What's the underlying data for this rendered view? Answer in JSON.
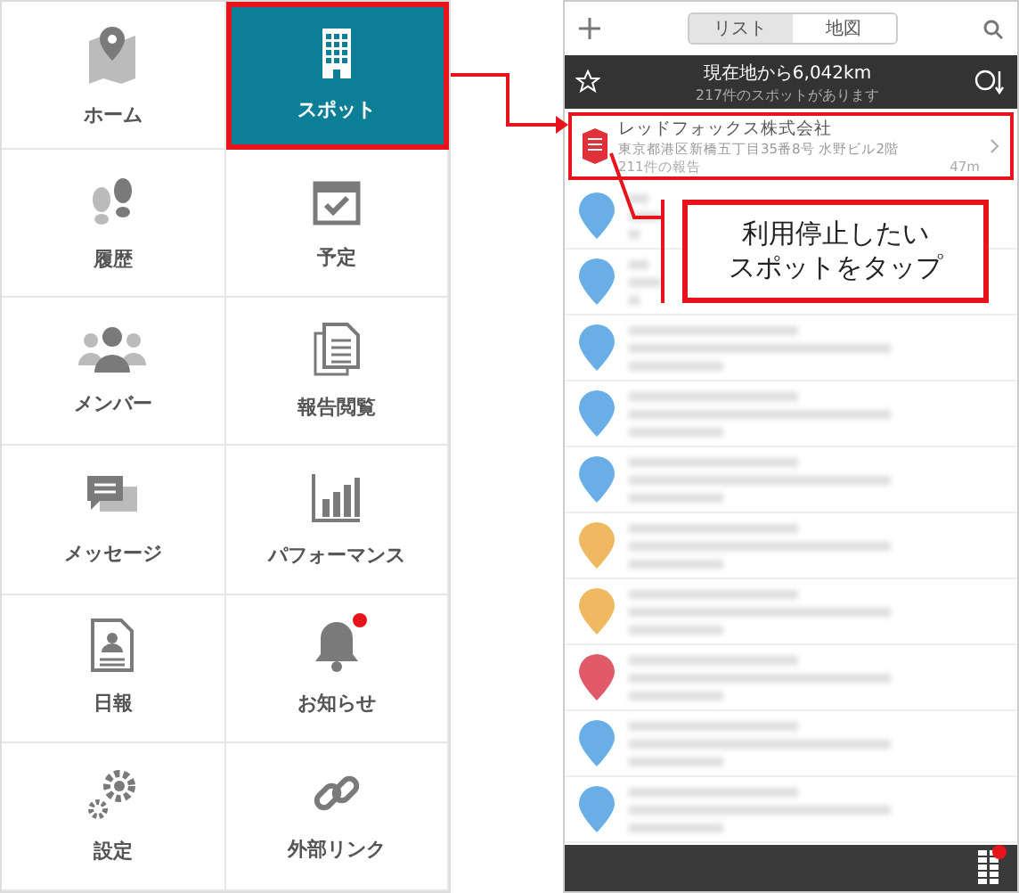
{
  "menu": [
    {
      "label": "ホーム",
      "selected": false,
      "badge": false
    },
    {
      "label": "スポット",
      "selected": true,
      "badge": false
    },
    {
      "label": "履歴",
      "selected": false,
      "badge": false
    },
    {
      "label": "予定",
      "selected": false,
      "badge": false
    },
    {
      "label": "メンバー",
      "selected": false,
      "badge": false
    },
    {
      "label": "報告閲覧",
      "selected": false,
      "badge": false
    },
    {
      "label": "メッセージ",
      "selected": false,
      "badge": false
    },
    {
      "label": "パフォーマンス",
      "selected": false,
      "badge": false
    },
    {
      "label": "日報",
      "selected": false,
      "badge": false
    },
    {
      "label": "お知らせ",
      "selected": false,
      "badge": true
    },
    {
      "label": "設定",
      "selected": false,
      "badge": false
    },
    {
      "label": "外部リンク",
      "selected": false,
      "badge": false
    }
  ],
  "phone": {
    "tabs": [
      {
        "label": "リスト",
        "selected": true
      },
      {
        "label": "地図",
        "selected": false
      }
    ],
    "header": {
      "title": "現在地から6,042km",
      "subtitle": "217件のスポットがあります"
    },
    "highlighted_spot": {
      "name": "レッドフォックス株式会社",
      "address": "東京都港区新橋五丁目35番8号 水野ビル2階",
      "reports": "211件の報告",
      "distance": "47m"
    },
    "blurred_spots": [
      {
        "color": "#6aaee8"
      },
      {
        "color": "#6aaee8"
      },
      {
        "color": "#6aaee8"
      },
      {
        "color": "#6aaee8"
      },
      {
        "color": "#6aaee8"
      },
      {
        "color": "#f0b860"
      },
      {
        "color": "#f0b860"
      },
      {
        "color": "#e05a6a"
      },
      {
        "color": "#6aaee8"
      },
      {
        "color": "#6aaee8"
      }
    ],
    "notification_dot": true
  },
  "callout": {
    "lines": [
      "利用停止したい",
      "スポットをタップ"
    ]
  }
}
